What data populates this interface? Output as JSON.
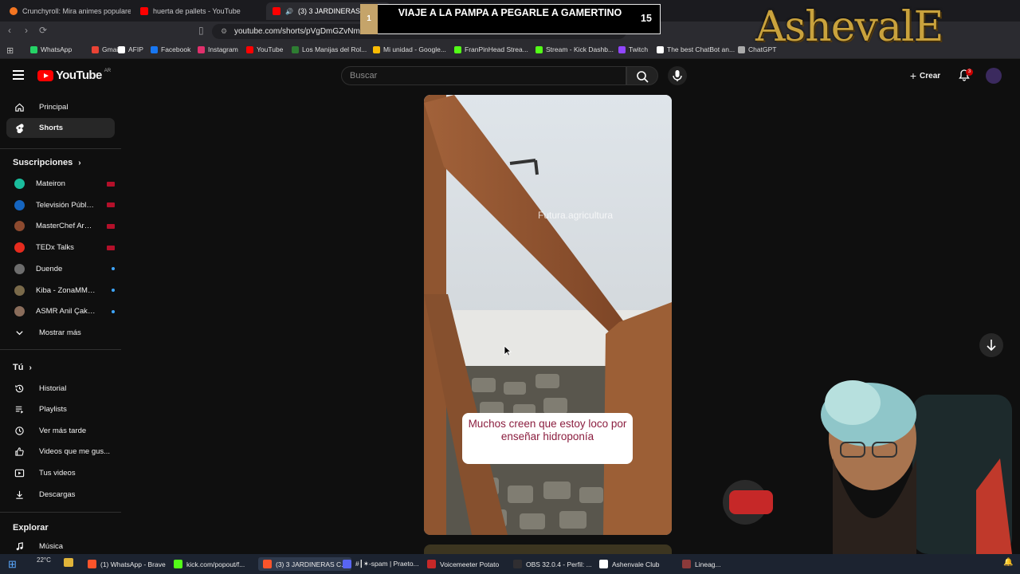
{
  "browser": {
    "tabs": [
      {
        "title": "Crunchyroll: Mira animes populares,",
        "color": "#f47521"
      },
      {
        "title": "huerta de pallets - YouTube",
        "color": "#ff0000"
      },
      {
        "title": "(3) 3 JARDINERAS CON P",
        "color": "#ff0000"
      }
    ],
    "url": "youtube.com/shorts/pVgDmGZvNmU",
    "bookmarks": [
      {
        "label": "WhatsApp",
        "color": "#25d366"
      },
      {
        "label": "Gmail",
        "color": "#ea4335"
      },
      {
        "label": "AFIP",
        "color": "#ffffff"
      },
      {
        "label": "Facebook",
        "color": "#1877f2"
      },
      {
        "label": "Instagram",
        "color": "#e1306c"
      },
      {
        "label": "YouTube",
        "color": "#ff0000"
      },
      {
        "label": "Los Manijas del Rol...",
        "color": "#2e7d32"
      },
      {
        "label": "Mi unidad - Google...",
        "color": "#fbbc04"
      },
      {
        "label": "FranPinHead Strea...",
        "color": "#53fc18"
      },
      {
        "label": "Stream - Kick Dashb...",
        "color": "#53fc18"
      },
      {
        "label": "Twitch",
        "color": "#9146ff"
      },
      {
        "label": "The best ChatBot an...",
        "color": "#ffffff"
      },
      {
        "label": "ChatGPT",
        "color": "#aaaaaa"
      }
    ]
  },
  "overlay": {
    "number": "1",
    "title": "VIAJE A LA PAMPA A PEGARLE A GAMERTINO",
    "count": "15",
    "brand": "AshevalE"
  },
  "youtube": {
    "logo_text": "YouTube",
    "country": "AR",
    "search_placeholder": "Buscar",
    "create_label": "Crear",
    "notif_count": "3",
    "nav": [
      {
        "label": "Principal",
        "icon": "home-icon"
      },
      {
        "label": "Shorts",
        "icon": "shorts-icon"
      }
    ],
    "subs_heading": "Suscripciones",
    "subscriptions": [
      {
        "name": "Mateiron",
        "status": "live",
        "color": "#1abc9c"
      },
      {
        "name": "Televisión Pública",
        "status": "live",
        "color": "#1565c0"
      },
      {
        "name": "MasterChef Arge...",
        "status": "live",
        "color": "#8d4a2f"
      },
      {
        "name": "TEDx Talks",
        "status": "live",
        "color": "#e62b1e"
      },
      {
        "name": "Duende",
        "status": "new",
        "color": "#6d6d6d"
      },
      {
        "name": "Kiba - ZonaMMO...",
        "status": "new",
        "color": "#7a6a4a"
      },
      {
        "name": "ASMR Anil Çakm...",
        "status": "new",
        "color": "#8a6d5b"
      }
    ],
    "show_more": "Mostrar más",
    "you_heading": "Tú",
    "you_items": [
      {
        "label": "Historial",
        "icon": "history-icon"
      },
      {
        "label": "Playlists",
        "icon": "playlist-icon"
      },
      {
        "label": "Ver más tarde",
        "icon": "clock-icon"
      },
      {
        "label": "Videos que me gus...",
        "icon": "thumbs-up-icon"
      },
      {
        "label": "Tus videos",
        "icon": "video-icon"
      },
      {
        "label": "Descargas",
        "icon": "download-icon"
      }
    ],
    "explore_heading": "Explorar",
    "explore_items": [
      {
        "label": "Música",
        "icon": "music-icon"
      }
    ],
    "short": {
      "watermark": "Futura.agricultura",
      "caption": "Muchos creen que estoy loco por enseñar hidroponía"
    }
  },
  "taskbar": {
    "weather": "22°C",
    "items": [
      {
        "label": "(1) WhatsApp - Brave",
        "color": "#fb542b"
      },
      {
        "label": "kick.com/popout/f...",
        "color": "#53fc18"
      },
      {
        "label": "(3) 3 JARDINERAS C...",
        "color": "#fb542b"
      },
      {
        "label": "#┃✶-spam | Praeto...",
        "color": "#5865f2"
      },
      {
        "label": "Voicemeeter Potato",
        "color": "#c62828"
      },
      {
        "label": "OBS 32.0.4 - Perfil: ...",
        "color": "#302e31"
      },
      {
        "label": "Ashenvale Club",
        "color": "#ffffff"
      },
      {
        "label": "Lineag...",
        "color": "#8b3a3a"
      }
    ]
  }
}
